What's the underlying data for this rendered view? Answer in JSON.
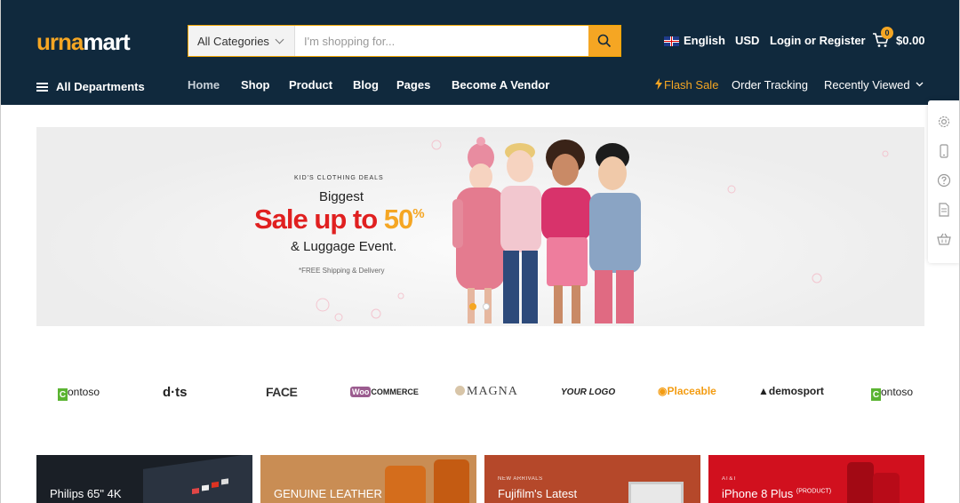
{
  "header": {
    "logo": {
      "part1": "urna",
      "part2": "mart"
    },
    "search": {
      "category_selected": "All Categories",
      "placeholder": "I'm shopping for..."
    },
    "language": "English",
    "currency": "USD",
    "account_link": "Login or Register",
    "cart": {
      "count": "0",
      "total": "$0.00"
    }
  },
  "nav": {
    "all_departments": "All Departments",
    "items": [
      "Home",
      "Shop",
      "Product",
      "Blog",
      "Pages",
      "Become A Vendor"
    ],
    "right": {
      "flash_sale": "Flash Sale",
      "order_tracking": "Order Tracking",
      "recently_viewed": "Recently Viewed"
    }
  },
  "hero": {
    "kicker": "KID'S CLOTHING DEALS",
    "line1": "Biggest",
    "sale_prefix": "Sale up to ",
    "sale_number": "50",
    "sale_symbol": "%",
    "line3": "& Luggage Event.",
    "note": "*FREE Shipping & Delivery"
  },
  "brands": [
    "ontoso",
    "d·ts",
    "FACE",
    "COMMERCE",
    "MAGNA",
    "YOUR LOGO",
    "Placeable",
    "demosport",
    "ontoso"
  ],
  "brand_glyphs": {
    "woo": "Woo",
    "c": "C"
  },
  "tiles": [
    {
      "kicker": "",
      "title": "Philips 65\" 4K"
    },
    {
      "kicker": "",
      "title": "GENUINE LEATHER"
    },
    {
      "kicker": "NEW ARRIVALS",
      "title": "Fujifilm's Latest"
    },
    {
      "kicker": "AT&T",
      "title": "iPhone 8 Plus",
      "suffix": "(PRODUCT)"
    }
  ],
  "colors": {
    "header_bg": "#10293d",
    "accent": "#f5a623",
    "sale_red": "#e02020"
  }
}
